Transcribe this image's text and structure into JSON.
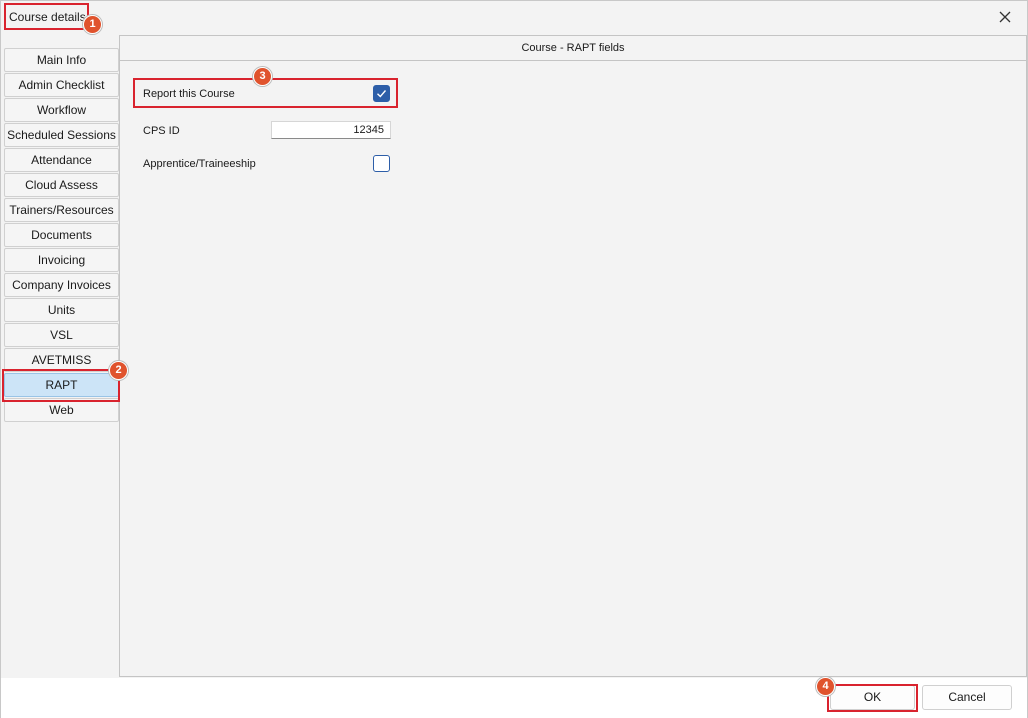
{
  "window": {
    "title": "Course details",
    "close_icon": "close-icon"
  },
  "sidebar": {
    "items": [
      {
        "label": "Main Info"
      },
      {
        "label": "Admin Checklist"
      },
      {
        "label": "Workflow"
      },
      {
        "label": "Scheduled Sessions"
      },
      {
        "label": "Attendance"
      },
      {
        "label": "Cloud Assess"
      },
      {
        "label": "Trainers/Resources"
      },
      {
        "label": "Documents"
      },
      {
        "label": "Invoicing"
      },
      {
        "label": "Company Invoices"
      },
      {
        "label": "Units"
      },
      {
        "label": "VSL"
      },
      {
        "label": "AVETMISS"
      },
      {
        "label": "RAPT",
        "active": true
      },
      {
        "label": "Web"
      }
    ]
  },
  "panel": {
    "header": "Course - RAPT fields",
    "fields": {
      "report_course": {
        "label": "Report this Course",
        "checked": true
      },
      "cps_id": {
        "label": "CPS ID",
        "value": "12345"
      },
      "apprentice": {
        "label": "Apprentice/Traineeship",
        "checked": false
      }
    }
  },
  "footer": {
    "ok_label": "OK",
    "cancel_label": "Cancel"
  },
  "annotations": {
    "badges": [
      "1",
      "2",
      "3",
      "4"
    ],
    "highlight_color": "#d9232e",
    "badge_color": "#e0532d"
  },
  "colors": {
    "accent": "#2d5ea8",
    "active_tab": "#cce4f7"
  }
}
